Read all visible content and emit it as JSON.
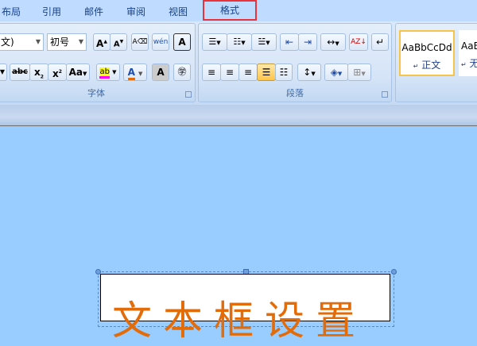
{
  "tabs": [
    "布局",
    "引用",
    "邮件",
    "审阅",
    "视图",
    "格式"
  ],
  "font_group": {
    "font_name": "文)",
    "font_size": "初号",
    "label": "字体",
    "change_case": "Aa"
  },
  "paragraph_group": {
    "label": "段落"
  },
  "styles": [
    {
      "preview": "AaBbCcDd",
      "name": "正文"
    },
    {
      "preview": "AaB",
      "name": "无"
    }
  ],
  "document": {
    "textbox_text": "文本框设置"
  },
  "colors": {
    "highlight": "#ff00ff",
    "font_color": "#e36c0a",
    "selected_tab_outline": "#e8333a"
  }
}
